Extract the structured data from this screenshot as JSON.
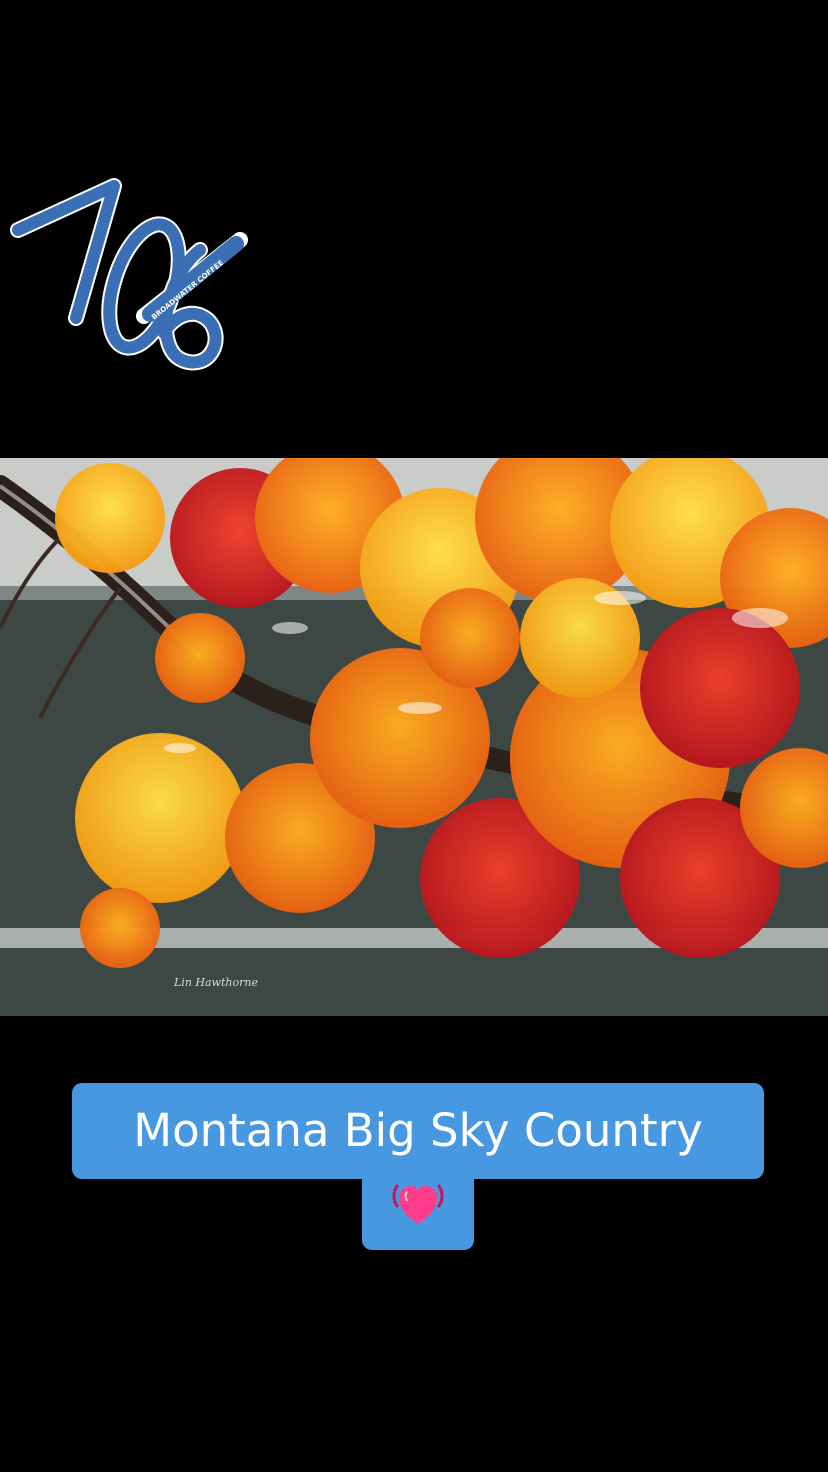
{
  "logo": {
    "numerals": "706",
    "brand_text": "BROADWATER COFFEE",
    "color": "#3a6fb5",
    "outline_color": "#ffffff"
  },
  "video": {
    "photo_credit": "Lin Hawthorne",
    "background_color": "#3b4643"
  },
  "caption": {
    "text": "Montana Big Sky Country",
    "emoji_icon": "beating-heart-icon",
    "background_color": "#4797e1",
    "text_color": "#ffffff"
  }
}
